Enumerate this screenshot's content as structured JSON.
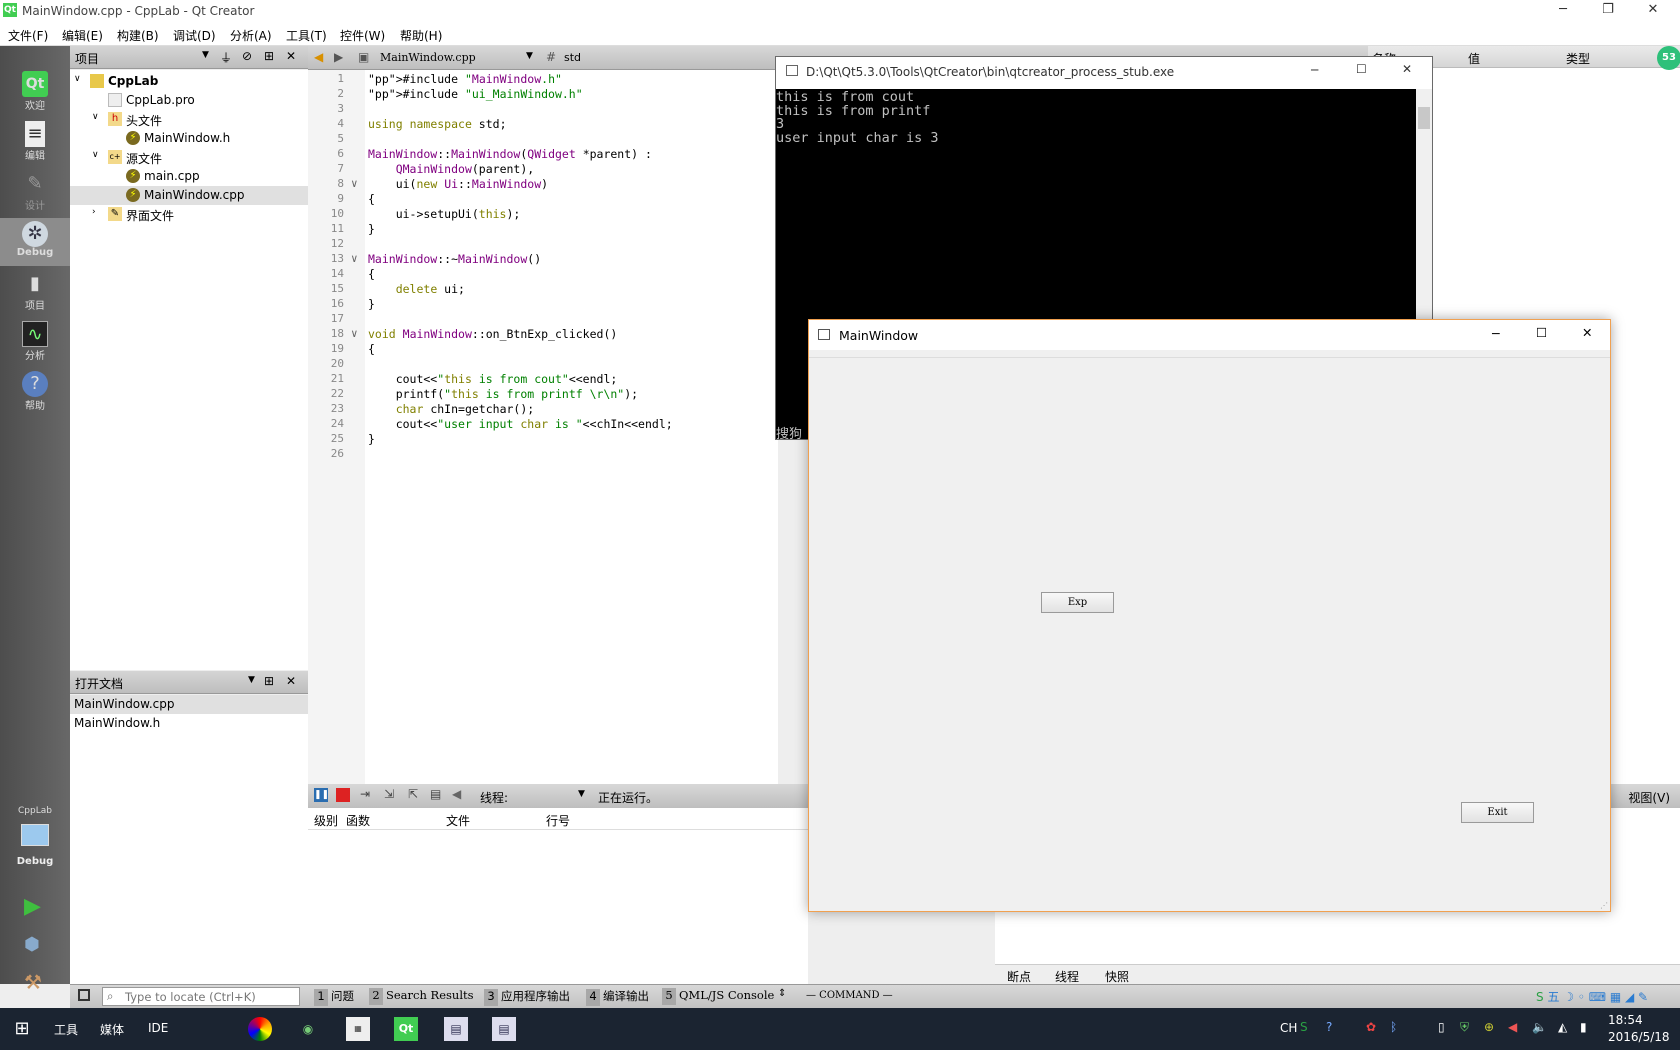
{
  "app": {
    "title": "MainWindow.cpp - CppLab - Qt Creator",
    "icon": "Qt"
  },
  "menu": [
    "文件(F)",
    "编辑(E)",
    "构建(B)",
    "调试(D)",
    "分析(A)",
    "工具(T)",
    "控件(W)",
    "帮助(H)"
  ],
  "modes": [
    {
      "label": "欢迎",
      "icon": "qt-logo-icon"
    },
    {
      "label": "编辑",
      "icon": "document-icon"
    },
    {
      "label": "设计",
      "icon": "pencil-icon"
    },
    {
      "label": "Debug",
      "icon": "bug-icon"
    },
    {
      "label": "项目",
      "icon": "book-icon"
    },
    {
      "label": "分析",
      "icon": "monitor-icon"
    },
    {
      "label": "帮助",
      "icon": "help-icon"
    }
  ],
  "kit": {
    "project": "CppLab",
    "mode": "Debug"
  },
  "projects": {
    "header": "项目",
    "tree": [
      {
        "label": "CppLab",
        "level": 0
      },
      {
        "label": "CppLab.pro",
        "level": 1
      },
      {
        "label": "头文件",
        "level": 1
      },
      {
        "label": "MainWindow.h",
        "level": 2
      },
      {
        "label": "源文件",
        "level": 1
      },
      {
        "label": "main.cpp",
        "level": 2
      },
      {
        "label": "MainWindow.cpp",
        "level": 2
      },
      {
        "label": "界面文件",
        "level": 1
      }
    ]
  },
  "open_docs": {
    "header": "打开文档",
    "items": [
      "MainWindow.cpp",
      "MainWindow.h"
    ]
  },
  "editor": {
    "file": "MainWindow.cpp",
    "symbol": "std",
    "line_numbers": [
      "1",
      "2",
      "3",
      "4",
      "5",
      "6",
      "7",
      "8",
      "9",
      "10",
      "11",
      "12",
      "13",
      "14",
      "15",
      "16",
      "17",
      "18",
      "19",
      "20",
      "21",
      "22",
      "23",
      "24",
      "25",
      "26"
    ],
    "lines": [
      "#include \"MainWindow.h\"",
      "#include \"ui_MainWindow.h\"",
      "",
      "using namespace std;",
      "",
      "MainWindow::MainWindow(QWidget *parent) :",
      "    QMainWindow(parent),",
      "    ui(new Ui::MainWindow)",
      "{",
      "    ui->setupUi(this);",
      "}",
      "",
      "MainWindow::~MainWindow()",
      "{",
      "    delete ui;",
      "}",
      "",
      "void MainWindow::on_BtnExp_clicked()",
      "{",
      "",
      "    cout<<\"this is from cout\"<<endl;",
      "    printf(\"this is from printf \\r\\n\");",
      "    char chIn=getchar();",
      "    cout<<\"user input char is \"<<chIn<<endl;",
      "}",
      ""
    ]
  },
  "console": {
    "title": "D:\\Qt\\Qt5.3.0\\Tools\\QtCreator\\bin\\qtcreator_process_stub.exe",
    "output": "this is from cout\nthis is from printf\n3\nuser input char is 3",
    "ime": "搜狗"
  },
  "mainwindow": {
    "title": "MainWindow",
    "exp_label": "Exp",
    "exit_label": "Exit"
  },
  "debugger": {
    "thread_label": "线程:",
    "status": "正在运行。",
    "cols": [
      "级别",
      "函数",
      "文件",
      "行号"
    ]
  },
  "right": {
    "cols": [
      "名称",
      "值",
      "类型"
    ],
    "view": "视图(V)",
    "tabs": [
      "断点",
      "线程",
      "快照"
    ],
    "badge": "53"
  },
  "statusbar": {
    "locate_placeholder": "Type to locate (Ctrl+K)",
    "tabs": [
      {
        "n": "1",
        "label": "问题"
      },
      {
        "n": "2",
        "label": "Search Results"
      },
      {
        "n": "3",
        "label": "应用程序输出"
      },
      {
        "n": "4",
        "label": "编译输出"
      },
      {
        "n": "5",
        "label": "QML/JS Console"
      }
    ],
    "command": "— COMMAND —"
  },
  "taskbar": {
    "items": [
      "工具",
      "媒体",
      "IDE"
    ],
    "tray": [
      "CH"
    ],
    "time": "18:54",
    "date": "2016/5/18"
  }
}
